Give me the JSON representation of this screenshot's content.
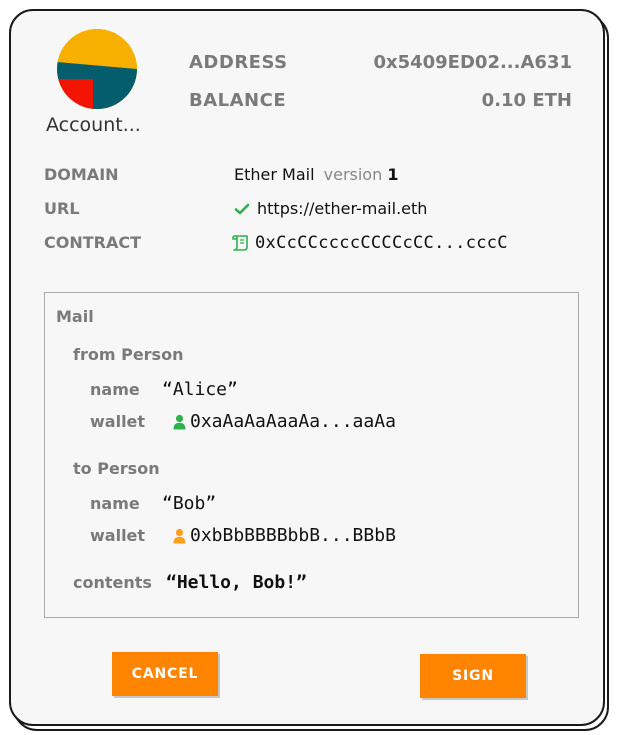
{
  "account": {
    "name": "Account...",
    "address_label": "ADDRESS",
    "address_value": "0x5409ED02...A631",
    "balance_label": "BALANCE",
    "balance_value": "0.10 ETH",
    "avatar_colors": [
      "#f8b000",
      "#035d6c",
      "#f21400"
    ]
  },
  "domain": {
    "domain_label": "DOMAIN",
    "domain_name": "Ether Mail",
    "version_label": "version",
    "version_value": "1",
    "url_label": "URL",
    "url_value": "https://ether-mail.eth",
    "contract_label": "CONTRACT",
    "contract_value": "0xCcCCccccCCCCcCC...cccC"
  },
  "message": {
    "type": "Mail",
    "from_label": "from Person",
    "from_name_key": "name",
    "from_name_value": "“Alice”",
    "from_wallet_key": "wallet",
    "from_wallet_value": "0xaAaAaAaaAa...aaAa",
    "to_label": "to Person",
    "to_name_key": "name",
    "to_name_value": "“Bob”",
    "to_wallet_key": "wallet",
    "to_wallet_value": "0xbBbBBBBbbB...BBbB",
    "contents_key": "contents",
    "contents_value": "“Hello, Bob!”"
  },
  "actions": {
    "cancel_label": "CANCEL",
    "sign_label": "SIGN"
  },
  "colors": {
    "accent": "#ff8400",
    "verified": "#2bb24c",
    "wallet_from": "#2bb24c",
    "wallet_to": "#ff9f1a",
    "contract_icon": "#2bb24c"
  },
  "icons": {
    "url_status": "check-icon",
    "contract": "contract-icon",
    "from_wallet": "person-icon",
    "to_wallet": "person-icon"
  }
}
